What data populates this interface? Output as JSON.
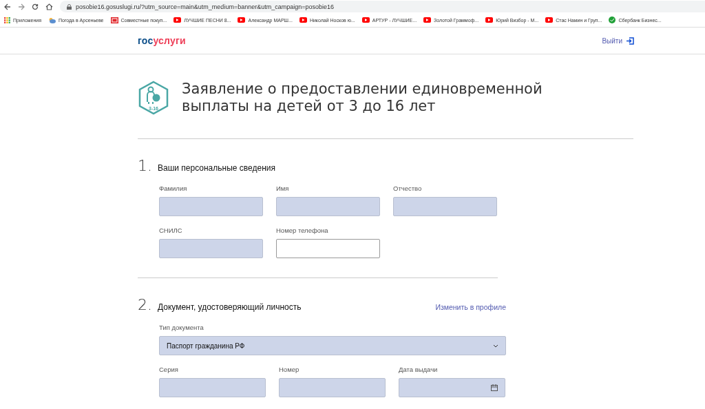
{
  "browser": {
    "url": "posobie16.gosuslugi.ru/?utm_source=main&utm_medium=banner&utm_campaign=posobie16",
    "bookmarks": [
      {
        "kind": "apps",
        "label": "Приложения"
      },
      {
        "kind": "weather",
        "label": "Погода в Арсеньеве"
      },
      {
        "kind": "shop",
        "label": "Совместные покуп..."
      },
      {
        "kind": "video",
        "label": "ЛУЧШИЕ ПЕСНИ 8..."
      },
      {
        "kind": "video",
        "label": "Александр МАРШ..."
      },
      {
        "kind": "video",
        "label": "Николай Носков ю..."
      },
      {
        "kind": "video",
        "label": "АРТУР - ЛУЧШИЕ..."
      },
      {
        "kind": "video",
        "label": "Золотой Граммоф..."
      },
      {
        "kind": "video",
        "label": "Юрий Визбор - М..."
      },
      {
        "kind": "video",
        "label": "Стас Намин и Груп..."
      },
      {
        "kind": "bank",
        "label": "Сбербанк Бизнес..."
      }
    ]
  },
  "header": {
    "logo_left": "гос",
    "logo_right": "услуги",
    "logout": "Выйти"
  },
  "title_badge": "3-16",
  "title": "Заявление о предоставлении единовременной выплаты на детей от 3 до 16 лет",
  "sections": [
    {
      "number": "1.",
      "title": "Ваши персональные сведения",
      "rows": [
        [
          {
            "kind": "text",
            "label": "Фамилия",
            "disabled": true
          },
          {
            "kind": "text",
            "label": "Имя",
            "disabled": true
          },
          {
            "kind": "text",
            "label": "Отчество",
            "disabled": true
          }
        ],
        [
          {
            "kind": "text",
            "label": "СНИЛС",
            "disabled": true
          },
          {
            "kind": "text",
            "label": "Номер телефона",
            "disabled": false
          }
        ]
      ]
    },
    {
      "number": "2.",
      "title": "Документ, удостоверяющий личность",
      "link": "Изменить в профиле",
      "rows": [
        [
          {
            "kind": "select",
            "label": "Тип документа",
            "value": "Паспорт гражданина РФ",
            "disabled": true
          }
        ],
        [
          {
            "kind": "text",
            "label": "Серия",
            "disabled": true
          },
          {
            "kind": "text",
            "label": "Номер",
            "disabled": true
          },
          {
            "kind": "date",
            "label": "Дата выдачи",
            "disabled": true
          }
        ]
      ]
    }
  ]
}
